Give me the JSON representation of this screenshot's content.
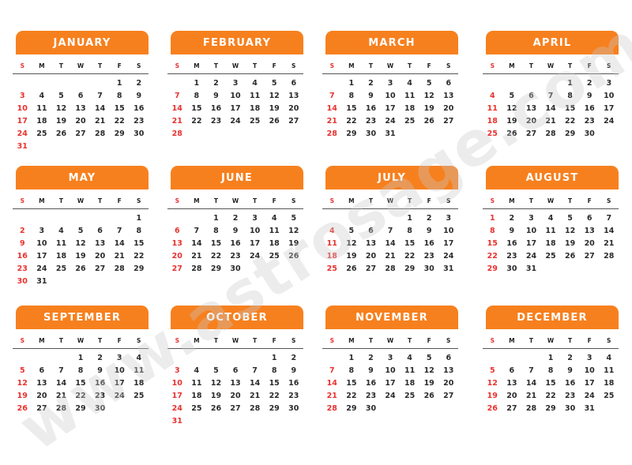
{
  "watermark": "www.astrosage.com",
  "colors": {
    "header": "#f7801e",
    "sunday": "#e8322f",
    "text": "#2b2b2b"
  },
  "weekday_labels": [
    "S",
    "M",
    "T",
    "W",
    "T",
    "F",
    "S"
  ],
  "months": [
    {
      "name": "JANUARY",
      "weeks": [
        [
          null,
          null,
          null,
          null,
          null,
          1,
          2
        ],
        [
          3,
          4,
          5,
          6,
          7,
          8,
          9
        ],
        [
          10,
          11,
          12,
          13,
          14,
          15,
          16
        ],
        [
          17,
          18,
          19,
          20,
          21,
          22,
          23
        ],
        [
          24,
          25,
          26,
          27,
          28,
          29,
          30
        ],
        [
          31
        ]
      ]
    },
    {
      "name": "FEBRUARY",
      "weeks": [
        [
          null,
          1,
          2,
          3,
          4,
          5,
          6
        ],
        [
          7,
          8,
          9,
          10,
          11,
          12,
          13
        ],
        [
          14,
          15,
          16,
          17,
          18,
          19,
          20
        ],
        [
          21,
          22,
          23,
          24,
          25,
          26,
          27
        ],
        [
          28
        ]
      ]
    },
    {
      "name": "MARCH",
      "weeks": [
        [
          null,
          1,
          2,
          3,
          4,
          5,
          6
        ],
        [
          7,
          8,
          9,
          10,
          11,
          12,
          13
        ],
        [
          14,
          15,
          16,
          17,
          18,
          19,
          20
        ],
        [
          21,
          22,
          23,
          24,
          25,
          26,
          27
        ],
        [
          28,
          29,
          30,
          31
        ]
      ]
    },
    {
      "name": "APRIL",
      "weeks": [
        [
          null,
          null,
          null,
          null,
          1,
          2,
          3
        ],
        [
          4,
          5,
          6,
          7,
          8,
          9,
          10
        ],
        [
          11,
          12,
          13,
          14,
          15,
          16,
          17
        ],
        [
          18,
          19,
          20,
          21,
          22,
          23,
          24
        ],
        [
          25,
          26,
          27,
          28,
          29,
          30
        ]
      ]
    },
    {
      "name": "MAY",
      "weeks": [
        [
          null,
          null,
          null,
          null,
          null,
          null,
          1
        ],
        [
          2,
          3,
          4,
          5,
          6,
          7,
          8
        ],
        [
          9,
          10,
          11,
          12,
          13,
          14,
          15
        ],
        [
          16,
          17,
          18,
          19,
          20,
          21,
          22
        ],
        [
          23,
          24,
          25,
          26,
          27,
          28,
          29
        ],
        [
          30,
          31
        ]
      ]
    },
    {
      "name": "JUNE",
      "weeks": [
        [
          null,
          null,
          1,
          2,
          3,
          4,
          5
        ],
        [
          6,
          7,
          8,
          9,
          10,
          11,
          12
        ],
        [
          13,
          14,
          15,
          16,
          17,
          18,
          19
        ],
        [
          20,
          21,
          22,
          23,
          24,
          25,
          26
        ],
        [
          27,
          28,
          29,
          30
        ]
      ]
    },
    {
      "name": "JULY",
      "weeks": [
        [
          null,
          null,
          null,
          null,
          1,
          2,
          3
        ],
        [
          4,
          5,
          6,
          7,
          8,
          9,
          10
        ],
        [
          11,
          12,
          13,
          14,
          15,
          16,
          17
        ],
        [
          18,
          19,
          20,
          21,
          22,
          23,
          24
        ],
        [
          25,
          26,
          27,
          28,
          29,
          30,
          31
        ]
      ]
    },
    {
      "name": "AUGUST",
      "weeks": [
        [
          1,
          2,
          3,
          4,
          5,
          6,
          7
        ],
        [
          8,
          9,
          10,
          11,
          12,
          13,
          14
        ],
        [
          15,
          16,
          17,
          18,
          19,
          20,
          21
        ],
        [
          22,
          23,
          24,
          25,
          26,
          27,
          28
        ],
        [
          29,
          30,
          31
        ]
      ]
    },
    {
      "name": "SEPTEMBER",
      "weeks": [
        [
          null,
          null,
          null,
          1,
          2,
          3,
          4
        ],
        [
          5,
          6,
          7,
          8,
          9,
          10,
          11
        ],
        [
          12,
          13,
          14,
          15,
          16,
          17,
          18
        ],
        [
          19,
          20,
          21,
          22,
          23,
          24,
          25
        ],
        [
          26,
          27,
          28,
          29,
          30
        ]
      ]
    },
    {
      "name": "OCTOBER",
      "weeks": [
        [
          null,
          null,
          null,
          null,
          null,
          1,
          2
        ],
        [
          3,
          4,
          5,
          6,
          7,
          8,
          9
        ],
        [
          10,
          11,
          12,
          13,
          14,
          15,
          16
        ],
        [
          17,
          18,
          19,
          20,
          21,
          22,
          23
        ],
        [
          24,
          25,
          26,
          27,
          28,
          29,
          30
        ],
        [
          31
        ]
      ]
    },
    {
      "name": "NOVEMBER",
      "weeks": [
        [
          null,
          1,
          2,
          3,
          4,
          5,
          6
        ],
        [
          7,
          8,
          9,
          10,
          11,
          12,
          13
        ],
        [
          14,
          15,
          16,
          17,
          18,
          19,
          20
        ],
        [
          21,
          22,
          23,
          24,
          25,
          26,
          27
        ],
        [
          28,
          29,
          30
        ]
      ]
    },
    {
      "name": "DECEMBER",
      "weeks": [
        [
          null,
          null,
          null,
          1,
          2,
          3,
          4
        ],
        [
          5,
          6,
          7,
          8,
          9,
          10,
          11
        ],
        [
          12,
          13,
          14,
          15,
          16,
          17,
          18
        ],
        [
          19,
          20,
          21,
          22,
          23,
          24,
          25
        ],
        [
          26,
          27,
          28,
          29,
          30,
          31
        ]
      ]
    }
  ]
}
